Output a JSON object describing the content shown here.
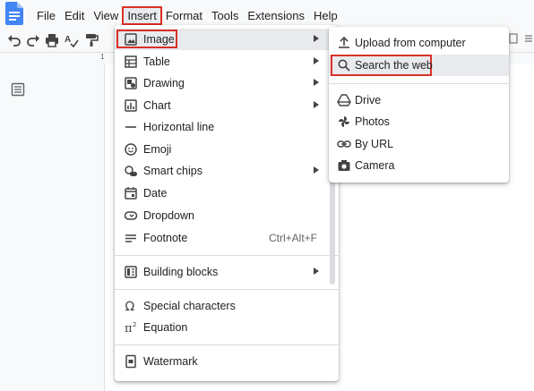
{
  "menubar": {
    "items": [
      "File",
      "Edit",
      "View",
      "Insert",
      "Format",
      "Tools",
      "Extensions",
      "Help"
    ]
  },
  "ruler": {
    "marker": "1"
  },
  "insert_menu": {
    "items": [
      {
        "label": "Image",
        "icon": "image-icon"
      },
      {
        "label": "Table",
        "icon": "table-icon"
      },
      {
        "label": "Drawing",
        "icon": "drawing-icon"
      },
      {
        "label": "Chart",
        "icon": "chart-icon"
      },
      {
        "label": "Horizontal line",
        "icon": "horizontal-line-icon"
      },
      {
        "label": "Emoji",
        "icon": "emoji-icon"
      },
      {
        "label": "Smart chips",
        "icon": "smart-chips-icon"
      },
      {
        "label": "Date",
        "icon": "date-icon"
      },
      {
        "label": "Dropdown",
        "icon": "dropdown-icon"
      },
      {
        "label": "Footnote",
        "icon": "footnote-icon",
        "shortcut": "Ctrl+Alt+F"
      },
      {
        "label": "Building blocks",
        "icon": "building-blocks-icon"
      },
      {
        "label": "Special characters",
        "icon": "omega-icon"
      },
      {
        "label": "Equation",
        "icon": "pi-icon"
      },
      {
        "label": "Watermark",
        "icon": "watermark-icon"
      }
    ]
  },
  "image_submenu": {
    "items": [
      {
        "label": "Upload from computer",
        "icon": "upload-icon"
      },
      {
        "label": "Search the web",
        "icon": "search-icon"
      },
      {
        "label": "Drive",
        "icon": "drive-icon"
      },
      {
        "label": "Photos",
        "icon": "photos-icon"
      },
      {
        "label": "By URL",
        "icon": "link-icon"
      },
      {
        "label": "Camera",
        "icon": "camera-icon"
      }
    ]
  },
  "colors": {
    "highlight_border": "#d93025",
    "doc_blue": "#4285f4",
    "hover": "#e8eaed"
  }
}
